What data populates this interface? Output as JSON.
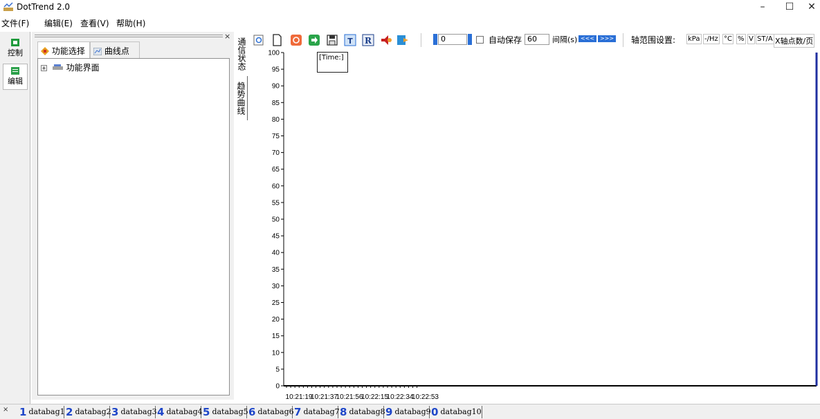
{
  "window": {
    "title": "DotTrend 2.0",
    "controls": {
      "minimize": "–",
      "maximize": "☐",
      "close": "✕"
    }
  },
  "menu": [
    {
      "label": "文件(F)"
    },
    {
      "label": "编辑(E)"
    },
    {
      "label": "查看(V)"
    },
    {
      "label": "帮助(H)"
    }
  ],
  "side_bar": {
    "items": [
      {
        "label": "控制",
        "icon": "control-icon"
      },
      {
        "label": "编辑",
        "icon": "edit-icon"
      }
    ]
  },
  "left_panel": {
    "close": "×",
    "tabs": [
      {
        "label": "功能选择",
        "icon": "function-select-icon"
      },
      {
        "label": "曲线点位",
        "icon": "curve-points-icon"
      }
    ],
    "tree": [
      {
        "expander": "+",
        "label": "功能界面",
        "icon": "interface-icon"
      }
    ]
  },
  "vertical_tabs": [
    {
      "label": "通信状态"
    },
    {
      "label": "趋势曲线"
    }
  ],
  "toolbar": {
    "spin_value": "0",
    "autosave_label": "自动保存",
    "autosave_value": "60",
    "interval_label": "间隔(s)",
    "prev_button": "<<<",
    "next_button": ">>>",
    "axis_label": "轴范围设置:",
    "units": [
      "kPa",
      "-/Hz",
      "°C",
      "%",
      "V",
      "ST/A"
    ],
    "xaxis_points_label": "X轴点数/页",
    "colors": {
      "accent": "#2a6fd6"
    }
  },
  "chart_data": {
    "type": "line",
    "title": "",
    "tooltip_label": "[Time:]",
    "xlabel": "",
    "ylabel": "",
    "ylim": [
      0,
      100
    ],
    "y_ticks": [
      0,
      5,
      10,
      15,
      20,
      25,
      30,
      35,
      40,
      45,
      50,
      55,
      60,
      65,
      70,
      75,
      80,
      85,
      90,
      95,
      100
    ],
    "x_tick_labels": [
      "10:21:19",
      "10:21:37",
      "10:21:56",
      "10:22:15",
      "10:22:34",
      "10:22:53"
    ],
    "series": [],
    "grid": false
  },
  "bottom_tabs": {
    "close": "×",
    "items": [
      {
        "num": "1",
        "label": "databag1"
      },
      {
        "num": "2",
        "label": "databag2"
      },
      {
        "num": "3",
        "label": "databag3"
      },
      {
        "num": "4",
        "label": "databag4"
      },
      {
        "num": "5",
        "label": "databag5"
      },
      {
        "num": "6",
        "label": "databag6"
      },
      {
        "num": "7",
        "label": "databag7"
      },
      {
        "num": "8",
        "label": "databag8"
      },
      {
        "num": "9",
        "label": "databag9"
      },
      {
        "num": "0",
        "label": "databag10"
      }
    ]
  }
}
